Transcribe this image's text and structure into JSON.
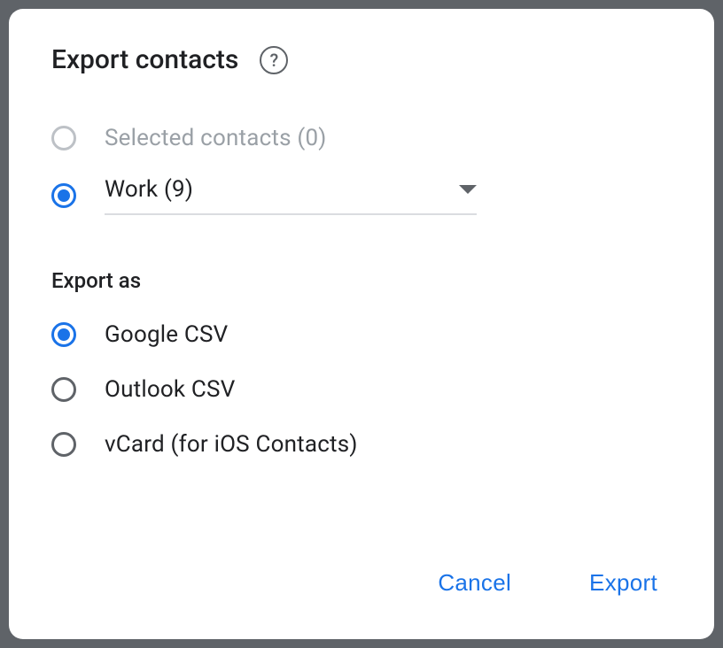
{
  "dialog": {
    "title": "Export contacts",
    "source_options": {
      "selected_contacts": {
        "label": "Selected contacts (0)",
        "selected": false,
        "disabled": true
      },
      "dropdown": {
        "label": "Work (9)",
        "selected": true
      }
    },
    "export_as_label": "Export as",
    "format_options": {
      "google_csv": {
        "label": "Google CSV",
        "selected": true
      },
      "outlook_csv": {
        "label": "Outlook CSV",
        "selected": false
      },
      "vcard": {
        "label": "vCard (for iOS Contacts)",
        "selected": false
      }
    },
    "actions": {
      "cancel": "Cancel",
      "export": "Export"
    }
  }
}
